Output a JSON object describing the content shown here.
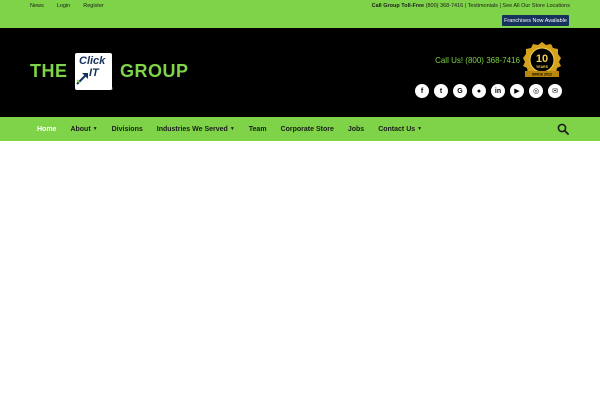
{
  "topbar": {
    "links": [
      "News",
      "Login",
      "Register"
    ],
    "tollfree_label": "Call Group Toll-Free",
    "tollfree_number": "(800) 368-7416",
    "sep1": "|",
    "testimonials": "Testimonials",
    "sep2": "|",
    "locations": "See All Our Store Locations",
    "franchise_button": "Franchises Now Available"
  },
  "logo": {
    "left_word": "THE",
    "click": "Click",
    "it": "IT",
    "right_word": "GROUP",
    "tm": "®"
  },
  "header": {
    "call_us": "Call Us! (800) 368-7416",
    "badge": {
      "years": "10",
      "label": "YEARS",
      "since": "SINCE 2012"
    },
    "socials": [
      {
        "name": "facebook-icon",
        "glyph": "f"
      },
      {
        "name": "twitter-icon",
        "glyph": "t"
      },
      {
        "name": "google-icon",
        "glyph": "G"
      },
      {
        "name": "map-pin-icon",
        "glyph": "●"
      },
      {
        "name": "linkedin-icon",
        "glyph": "in"
      },
      {
        "name": "youtube-icon",
        "glyph": "▶"
      },
      {
        "name": "instagram-icon",
        "glyph": "◎"
      },
      {
        "name": "email-icon",
        "glyph": "✉"
      }
    ]
  },
  "nav": {
    "items": [
      {
        "label": "Home",
        "active": true,
        "dropdown": false
      },
      {
        "label": "About",
        "active": false,
        "dropdown": true
      },
      {
        "label": "Divisions",
        "active": false,
        "dropdown": false
      },
      {
        "label": "Industries We Served",
        "active": false,
        "dropdown": true
      },
      {
        "label": "Team",
        "active": false,
        "dropdown": false
      },
      {
        "label": "Corporate Store",
        "active": false,
        "dropdown": false
      },
      {
        "label": "Jobs",
        "active": false,
        "dropdown": false
      },
      {
        "label": "Contact Us",
        "active": false,
        "dropdown": true
      }
    ]
  },
  "colors": {
    "brand_green": "#7ed348",
    "navy": "#16325c",
    "header_bg": "#000000",
    "gold": "#d4a21c"
  }
}
